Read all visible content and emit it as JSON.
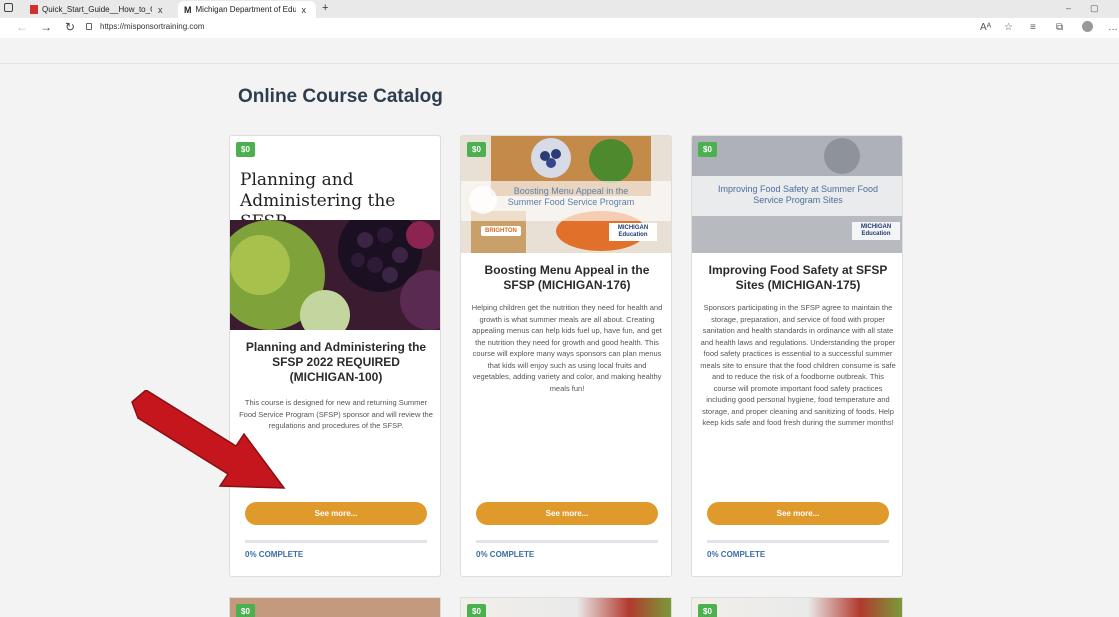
{
  "browser": {
    "tabs": [
      {
        "label": "Quick_Start_Guide__How_to_Cre",
        "close": "x"
      },
      {
        "label": "Michigan Department of Educati",
        "close": "x",
        "prefix": "M"
      }
    ],
    "new_tab": "+",
    "url": "https://misponsortraining.com"
  },
  "page": {
    "heading": "Online Course Catalog"
  },
  "cards": [
    {
      "price": "$0",
      "banner_text": "Planning and Administering the SFSP",
      "title": "Planning and Administering the SFSP 2022 REQUIRED (MICHIGAN-100)",
      "description": "This course is designed for new and returning Summer Food Service Program (SFSP) sponsor and will review the regulations and procedures of the SFSP.",
      "button": "See more...",
      "progress_label": "0% COMPLETE",
      "progress": 0
    },
    {
      "price": "$0",
      "banner_text": "Boosting Menu Appeal in the Summer Food Service Program",
      "logo_left": "BRIGHTON",
      "logo_right": "MICHIGAN Education",
      "title": "Boosting Menu Appeal in the SFSP (MICHIGAN-176)",
      "description": "Helping children get the nutrition they need for health and growth is what summer meals are all about. Creating appealing menus can help kids fuel up, have fun, and get the nutrition they need for growth and good health. This course will explore many ways sponsors can plan menus that kids will enjoy such as using local fruits and vegetables, adding variety and color, and making healthy meals fun!",
      "button": "See more...",
      "progress_label": "0% COMPLETE",
      "progress": 0
    },
    {
      "price": "$0",
      "banner_text": "Improving Food Safety at Summer Food Service Program Sites",
      "logo_right": "MICHIGAN Education",
      "title": "Improving Food Safety at SFSP Sites (MICHIGAN-175)",
      "description": "Sponsors participating in the SFSP agree to maintain the storage, preparation, and service of food with proper sanitation and health standards in ordinance with all state and health laws and regulations. Understanding the proper food safety practices is essential to a successful summer meals site to ensure that the food children consume is safe and to reduce the risk of a foodborne outbreak. This course will promote important food safety practices including good personal hygiene, food temperature and storage, and proper cleaning and sanitizing of foods. Help keep kids safe and food fresh during the summer months!",
      "button": "See more...",
      "progress_label": "0% COMPLETE",
      "progress": 0
    }
  ],
  "bottom_cards": [
    {
      "price": "$0"
    },
    {
      "price": "$0"
    },
    {
      "price": "$0"
    }
  ],
  "colors": {
    "price_badge": "#4caf50",
    "button": "#e09a2b",
    "complete_text": "#3a6ea8",
    "arrow": "#c4161c"
  }
}
